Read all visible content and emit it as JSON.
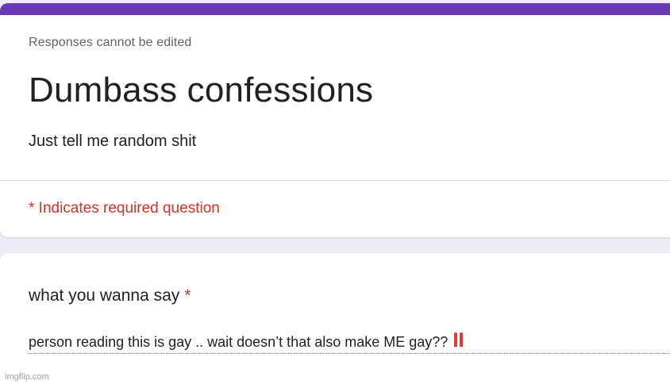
{
  "form": {
    "notice": "Responses cannot be edited",
    "title": "Dumbass confessions",
    "description": "Just tell me random shit",
    "required_note": "* Indicates required question"
  },
  "question": {
    "title": "what you wanna say",
    "required_marker": "*",
    "answer": "person reading this is gay .. wait doesn’t that also make ME gay??",
    "answer_icon": "double-exclamation-mark-icon"
  },
  "watermark": "imgflip.com",
  "colors": {
    "accent": "#673ab7",
    "background": "#f0ebf8",
    "required": "#d93025",
    "text": "#202124",
    "muted": "#5f6368"
  }
}
